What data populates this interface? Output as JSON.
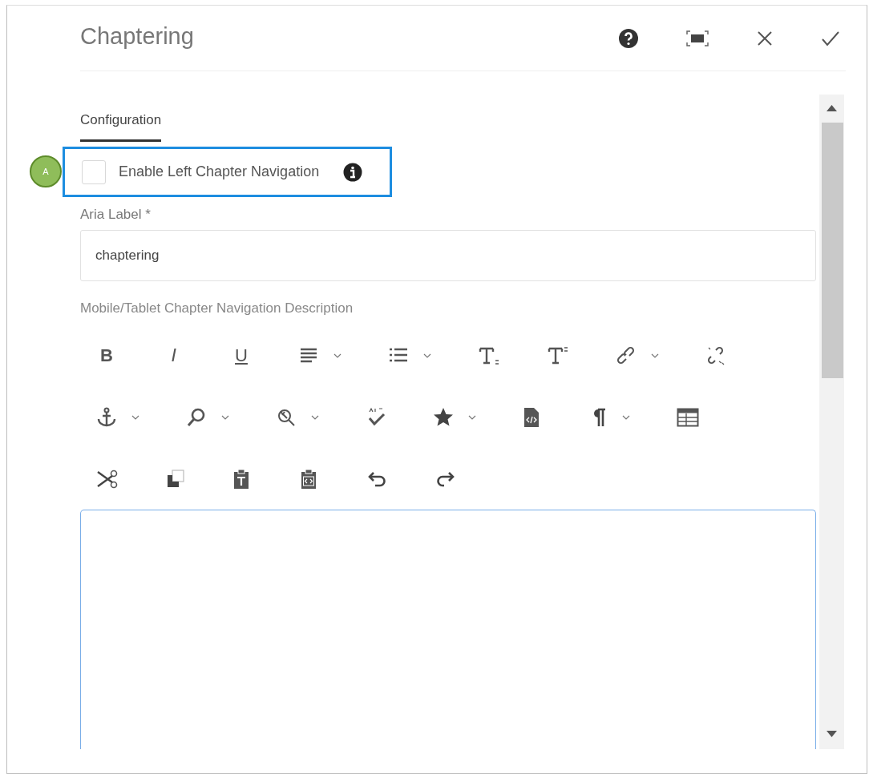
{
  "dialog": {
    "title": "Chaptering",
    "header_buttons": [
      {
        "kind": "help"
      },
      {
        "kind": "fullscreen"
      },
      {
        "kind": "close"
      },
      {
        "kind": "done"
      }
    ]
  },
  "tabs": [
    {
      "label": "Configuration",
      "selected": true
    }
  ],
  "callout": {
    "label": "A"
  },
  "checkbox": {
    "label": "Enable Left Chapter Navigation",
    "checked": false,
    "highlighted": true
  },
  "aria_field": {
    "label": "Aria Label *",
    "value": "chaptering"
  },
  "description": {
    "label": "Mobile/Tablet Chapter Navigation Description",
    "toolbar": [
      [
        {
          "kind": "bold",
          "label": "B",
          "dropdown": false
        },
        {
          "kind": "italic",
          "label": "I",
          "dropdown": false
        },
        {
          "kind": "underline",
          "label": "U",
          "dropdown": false
        },
        {
          "kind": "align",
          "dropdown": true
        },
        {
          "kind": "list",
          "dropdown": true
        },
        {
          "kind": "subscript",
          "dropdown": false
        },
        {
          "kind": "superscript",
          "dropdown": false
        },
        {
          "kind": "link",
          "dropdown": true
        },
        {
          "kind": "unlink",
          "dropdown": false
        }
      ],
      [
        {
          "kind": "anchor",
          "dropdown": true
        },
        {
          "kind": "find",
          "dropdown": true
        },
        {
          "kind": "replace",
          "dropdown": true
        },
        {
          "kind": "spellcheck",
          "dropdown": false
        },
        {
          "kind": "star",
          "dropdown": true
        },
        {
          "kind": "source",
          "dropdown": false
        },
        {
          "kind": "paragraph",
          "dropdown": true
        },
        {
          "kind": "table",
          "dropdown": false
        }
      ],
      [
        {
          "kind": "cut",
          "dropdown": false
        },
        {
          "kind": "copy",
          "dropdown": false
        },
        {
          "kind": "paste-text",
          "dropdown": false
        },
        {
          "kind": "paste-code",
          "dropdown": false
        },
        {
          "kind": "undo",
          "dropdown": false
        },
        {
          "kind": "redo",
          "dropdown": false
        }
      ]
    ]
  }
}
